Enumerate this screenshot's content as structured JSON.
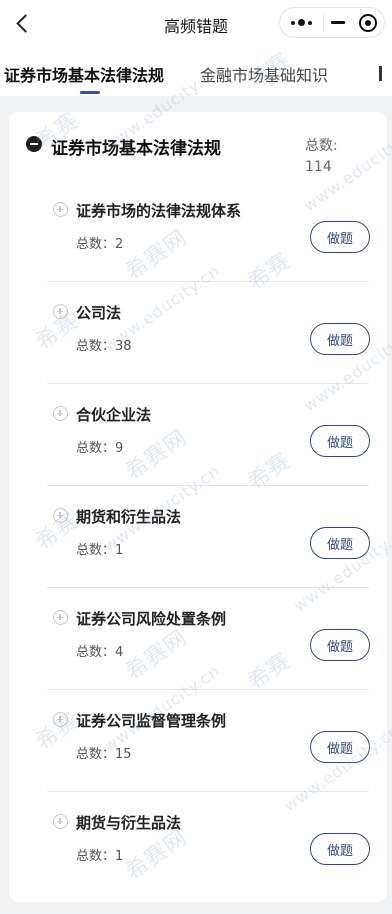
{
  "header": {
    "title": "高频错题",
    "back_icon": "back-arrow-icon",
    "more_icon": "more-dots-icon",
    "minimize_icon": "minimize-icon",
    "close_icon": "target-close-icon"
  },
  "tabs": [
    {
      "label": "证券市场基本法律法规",
      "active": true
    },
    {
      "label": "金融市场基础知识",
      "active": false
    }
  ],
  "colors": {
    "accent": "#2f55a4",
    "button_border": "#2f4a8a"
  },
  "section": {
    "title": "证券市场基本法律法规",
    "total_label": "总数:",
    "total_value": "114",
    "items": [
      {
        "title": "证券市场的法律法规体系",
        "count": "总数：2",
        "button": "做题"
      },
      {
        "title": "公司法",
        "count": "总数：38",
        "button": "做题"
      },
      {
        "title": "合伙企业法",
        "count": "总数：9",
        "button": "做题"
      },
      {
        "title": "期货和衍生品法",
        "count": "总数：1",
        "button": "做题"
      },
      {
        "title": "证券公司风险处置条例",
        "count": "总数：4",
        "button": "做题"
      },
      {
        "title": "证券公司监督管理条例",
        "count": "总数：15",
        "button": "做题"
      },
      {
        "title": "期货与衍生品法",
        "count": "总数：1",
        "button": "做题"
      }
    ]
  },
  "watermark": {
    "brand": "希赛",
    "site": "www.educity.cn",
    "net": "希赛网"
  }
}
